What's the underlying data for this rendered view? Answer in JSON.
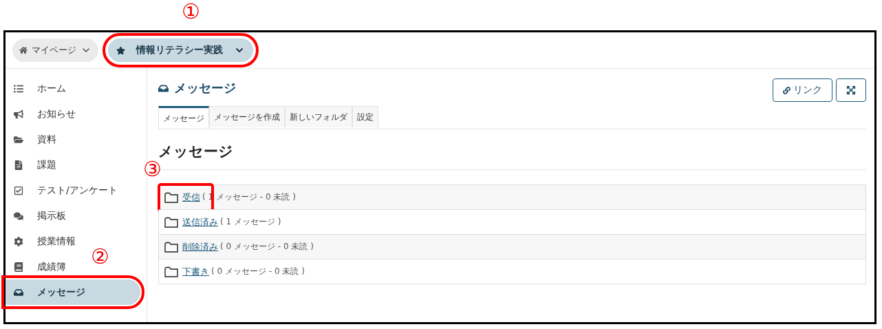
{
  "annotations": [
    {
      "label": "①"
    },
    {
      "label": "②"
    },
    {
      "label": "③"
    }
  ],
  "breadcrumbs": [
    {
      "label": "マイページ",
      "selected": false,
      "highlighted": false
    },
    {
      "label": "情報リテラシー実践",
      "selected": true,
      "highlighted": true
    }
  ],
  "sidebar": {
    "items": [
      {
        "label": "ホーム",
        "selected": false,
        "highlighted": false
      },
      {
        "label": "お知らせ",
        "selected": false,
        "highlighted": false
      },
      {
        "label": "資料",
        "selected": false,
        "highlighted": false
      },
      {
        "label": "課題",
        "selected": false,
        "highlighted": false
      },
      {
        "label": "テスト/アンケート",
        "selected": false,
        "highlighted": false
      },
      {
        "label": "掲示板",
        "selected": false,
        "highlighted": false
      },
      {
        "label": "授業情報",
        "selected": false,
        "highlighted": false
      },
      {
        "label": "成績簿",
        "selected": false,
        "highlighted": false
      },
      {
        "label": "メッセージ",
        "selected": true,
        "highlighted": true
      }
    ]
  },
  "page": {
    "title": "メッセージ",
    "link_button": "リンク"
  },
  "tabs": [
    {
      "label": "メッセージ",
      "selected": true
    },
    {
      "label": "メッセージを作成",
      "selected": false
    },
    {
      "label": "新しいフォルダ",
      "selected": false
    },
    {
      "label": "設定",
      "selected": false
    }
  ],
  "heading": "メッセージ",
  "folders": [
    {
      "name": "受信",
      "info": "( 1 メッセージ - 0 未読 )",
      "highlighted": true
    },
    {
      "name": "送信済み",
      "info": "( 1 メッセージ )",
      "highlighted": false
    },
    {
      "name": "削除済み",
      "info": "( 0 メッセージ - 0 未読 )",
      "highlighted": false
    },
    {
      "name": "下書き",
      "info": "( 0 メッセージ - 0 未読 )",
      "highlighted": false
    }
  ]
}
